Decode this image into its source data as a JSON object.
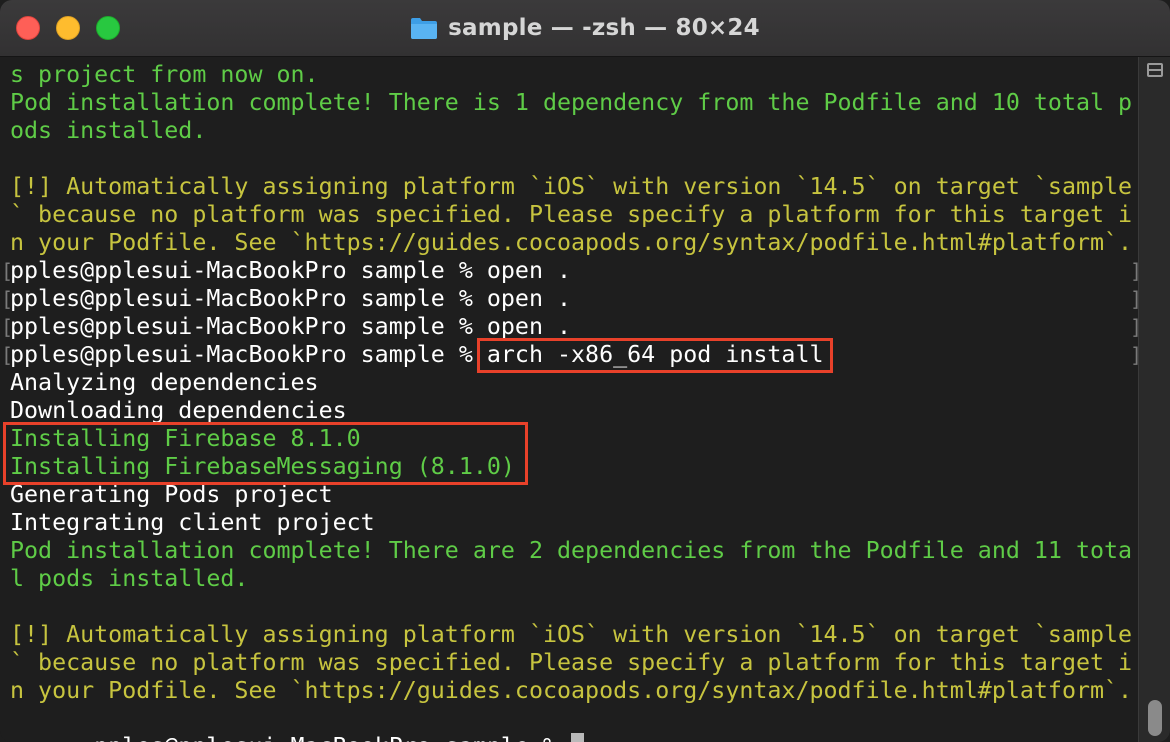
{
  "window": {
    "title": "sample — -zsh — 80×24",
    "title_icon": "folder-icon"
  },
  "colors": {
    "background": "#1e1e1e",
    "output_green": "#5fcc47",
    "warning_yellow": "#c7c43f",
    "prompt_white": "#ffffff",
    "highlight_red": "#e8412a"
  },
  "terminal": {
    "lines": [
      {
        "text": "s project from now on.",
        "style": "green"
      },
      {
        "text": "Pod installation complete! There is 1 dependency from the Podfile and 10 total p",
        "style": "green"
      },
      {
        "text": "ods installed.",
        "style": "green"
      },
      {
        "text": "",
        "style": "white"
      },
      {
        "text": "[!] Automatically assigning platform `iOS` with version `14.5` on target `sample",
        "style": "yellow"
      },
      {
        "text": "` because no platform was specified. Please specify a platform for this target i",
        "style": "yellow"
      },
      {
        "text": "n your Podfile. See `https://guides.cocoapods.org/syntax/podfile.html#platform`.",
        "style": "yellow"
      },
      {
        "text": "pples@pplesui-MacBookPro sample % open .",
        "style": "white"
      },
      {
        "text": "pples@pplesui-MacBookPro sample % open .",
        "style": "white"
      },
      {
        "text": "pples@pplesui-MacBookPro sample % open .",
        "style": "white"
      },
      {
        "text": "pples@pplesui-MacBookPro sample % arch -x86_64 pod install",
        "style": "white"
      },
      {
        "text": "Analyzing dependencies",
        "style": "white"
      },
      {
        "text": "Downloading dependencies",
        "style": "white"
      },
      {
        "text": "Installing Firebase 8.1.0",
        "style": "green"
      },
      {
        "text": "Installing FirebaseMessaging (8.1.0)",
        "style": "green"
      },
      {
        "text": "Generating Pods project",
        "style": "white"
      },
      {
        "text": "Integrating client project",
        "style": "white"
      },
      {
        "text": "Pod installation complete! There are 2 dependencies from the Podfile and 11 tota",
        "style": "green"
      },
      {
        "text": "l pods installed.",
        "style": "green"
      },
      {
        "text": "",
        "style": "white"
      },
      {
        "text": "[!] Automatically assigning platform `iOS` with version `14.5` on target `sample",
        "style": "yellow"
      },
      {
        "text": "` because no platform was specified. Please specify a platform for this target i",
        "style": "yellow"
      },
      {
        "text": "n your Podfile. See `https://guides.cocoapods.org/syntax/podfile.html#platform`.",
        "style": "yellow"
      }
    ],
    "prompt": "pples@pplesui-MacBookPro sample % ",
    "mark_left": "[",
    "mark_right": "]"
  }
}
